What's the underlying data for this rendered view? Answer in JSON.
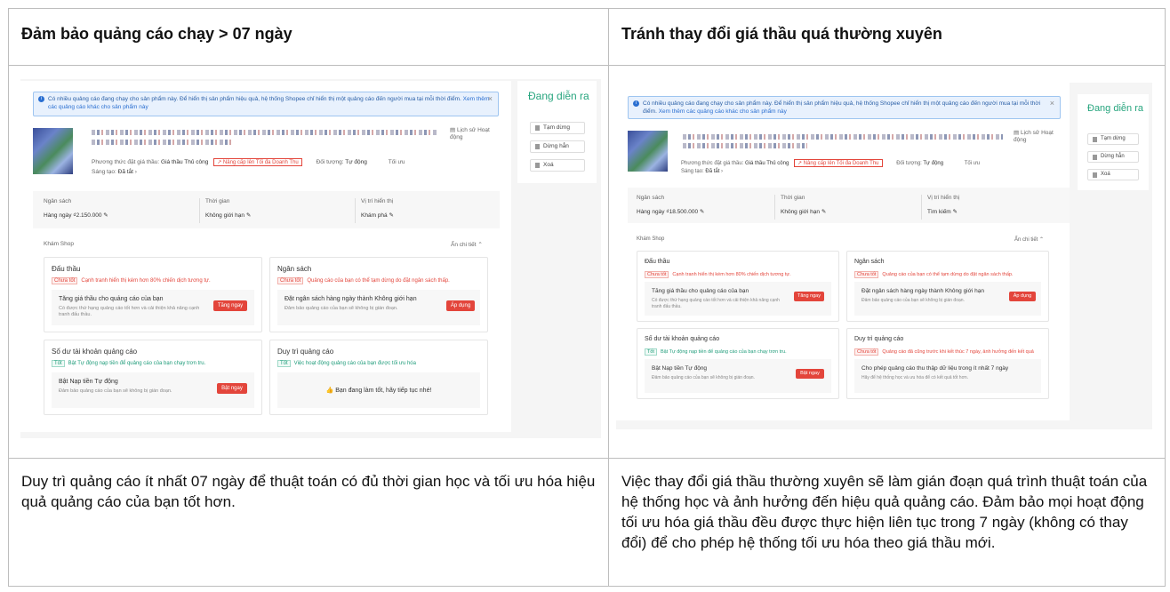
{
  "headers": {
    "left": "Đảm bảo quảng cáo chạy > 07 ngày",
    "right": "Tránh thay đổi giá thầu quá thường xuyên"
  },
  "captions": {
    "left": "Duy trì quảng cáo ít nhất 07 ngày để thuật toán có đủ thời gian học và tối ưu hóa hiệu quả quảng cáo của bạn tốt hơn.",
    "right": "Việc thay đổi giá thầu thường xuyên sẽ làm gián đoạn quá trình thuật toán của hệ thống học và ảnh hưởng đến hiệu quả quảng cáo. Đảm bảo mọi hoạt động tối ưu hóa giá thầu đều được thực hiện liên tục trong 7 ngày (không có thay đổi) để cho phép hệ thống tối ưu hóa theo giá thầu mới."
  },
  "colors": {
    "accent_red": "#e3453b",
    "status_green": "#27a57e",
    "info_blue": "#2a6fd1"
  },
  "left_screen": {
    "notice": "Có nhiều quảng cáo đang chạy cho sản phẩm này. Để hiển thị sản phẩm hiệu quả, hệ thống Shopee chỉ hiển thị một quảng cáo đến người mua tại mỗi thời điểm.",
    "notice_link": "Xem thêm các quảng cáo khác cho sản phẩm này",
    "history": "Lịch sử Hoạt động",
    "bid_method_label": "Phương thức đặt giá thầu:",
    "bid_method_value": "Giá thầu Thủ công",
    "upgrade": "↗ Nâng cấp lên Tối đa Doanh Thu",
    "target_label": "Đối tượng:",
    "target_value": "Tự động",
    "optimize": "Tối ưu",
    "creative_label": "Sáng tạo:",
    "creative_value": "Đã tắt",
    "budget_label": "Ngân sách",
    "budget_value": "Hàng ngày ₫2.150.000",
    "time_label": "Thời gian",
    "time_value": "Không giới hạn",
    "position_label": "Vị trí hiển thị",
    "position_value": "Khám phá",
    "explore": "Khám Shop",
    "collapse": "Ẩn chi tiết ⌃",
    "status": "Đang diễn ra",
    "pause": "Tạm dừng",
    "stop": "Dừng hẳn",
    "delete": "Xoá",
    "cards": {
      "bid": {
        "title": "Đấu thầu",
        "tag": "Chưa tốt",
        "status": "Cạnh tranh hiển thị kém hơn 80% chiến dịch tương tự.",
        "action": "Tăng giá thầu cho quảng cáo của bạn",
        "desc": "Có được thứ hạng quảng cáo tốt hơn và cải thiện khả năng cạnh tranh đấu thầu.",
        "btn": "Tăng ngay"
      },
      "budget": {
        "title": "Ngân sách",
        "tag": "Chưa tốt",
        "status": "Quảng cáo của bạn có thể tạm dừng do đặt ngân sách thấp.",
        "action": "Đặt ngân sách hàng ngày thành Không giới hạn",
        "desc": "Đảm bảo quảng cáo của bạn sẽ không bị gián đoạn.",
        "btn": "Áp dụng"
      },
      "balance": {
        "title": "Số dư tài khoản quảng cáo",
        "tag": "Tốt",
        "status": "Bật Tự động nạp tiền để quảng cáo của bạn chạy trơn tru.",
        "action": "Bật Nạp tiền Tự động",
        "desc": "Đảm bảo quảng cáo của bạn sẽ không bị gián đoạn.",
        "btn": "Bật ngay"
      },
      "maintain": {
        "title": "Duy trì quảng cáo",
        "tag": "Tốt",
        "status": "Việc hoạt động quảng cáo của bạn được tối ưu hóa",
        "message": "Bạn đang làm tốt, hãy tiếp tục nhé!"
      }
    }
  },
  "right_screen": {
    "notice": "Có nhiều quảng cáo đang chạy cho sản phẩm này. Để hiển thị sản phẩm hiệu quả, hệ thống Shopee chỉ hiển thị một quảng cáo đến người mua tại mỗi thời điểm.",
    "notice_link": "Xem thêm các quảng cáo khác cho sản phẩm này",
    "history": "Lịch sử Hoạt động",
    "bid_method_label": "Phương thức đặt giá thầu:",
    "bid_method_value": "Giá thầu Thủ công",
    "upgrade": "↗ Nâng cấp lên Tối đa Doanh Thu",
    "target_label": "Đối tượng:",
    "target_value": "Tự động",
    "optimize": "Tối ưu",
    "creative_label": "Sáng tạo:",
    "creative_value": "Đã tắt",
    "budget_label": "Ngân sách",
    "budget_value": "Hàng ngày ₫18.500.000",
    "time_label": "Thời gian",
    "time_value": "Không giới hạn",
    "position_label": "Vị trí hiển thị",
    "position_value": "Tìm kiếm",
    "explore": "Khám Shop",
    "collapse": "Ẩn chi tiết ⌃",
    "status": "Đang diễn ra",
    "pause": "Tạm dừng",
    "stop": "Dừng hẳn",
    "delete": "Xoá",
    "cards": {
      "bid": {
        "title": "Đấu thầu",
        "tag": "Chưa tốt",
        "status": "Cạnh tranh hiển thị kém hơn 80% chiến dịch tương tự.",
        "action": "Tăng giá thầu cho quảng cáo của bạn",
        "desc": "Có được thứ hạng quảng cáo tốt hơn và cải thiện khả năng cạnh tranh đấu thầu.",
        "btn": "Tăng ngay"
      },
      "budget": {
        "title": "Ngân sách",
        "tag": "Chưa tốt",
        "status": "Quảng cáo của bạn có thể tạm dừng do đặt ngân sách thấp.",
        "action": "Đặt ngân sách hàng ngày thành Không giới hạn",
        "desc": "Đảm bảo quảng cáo của bạn sẽ không bị gián đoạn.",
        "btn": "Áp dụng"
      },
      "balance": {
        "title": "Số dư tài khoản quảng cáo",
        "tag": "Tốt",
        "status": "Bật Tự động nạp tiền để quảng cáo của bạn chạy trơn tru.",
        "action": "Bật Nạp tiền Tự động",
        "desc": "Đảm bảo quảng cáo của bạn sẽ không bị gián đoạn.",
        "btn": "Bật ngay"
      },
      "maintain": {
        "title": "Duy trì quảng cáo",
        "tag": "Chưa tốt",
        "status": "Quảng cáo đã cũng trước khi kết thúc 7 ngày, ảnh hưởng đến kết quả",
        "action": "Cho phép quảng cáo thu thập dữ liệu trong ít nhất 7 ngày",
        "desc": "Hãy để hệ thống học và ưu hóa để có kết quả tốt hơn."
      }
    }
  }
}
